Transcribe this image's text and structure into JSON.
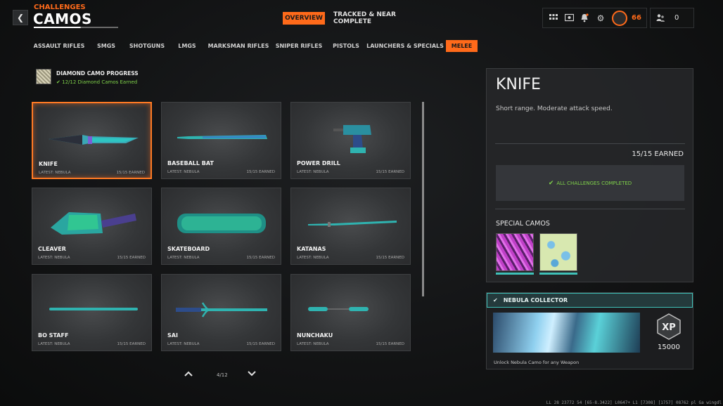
{
  "header": {
    "back_icon": "chevron-left-icon",
    "subtitle": "CHALLENGES",
    "title": "CAMOS",
    "tabs": [
      {
        "label": "OVERVIEW",
        "active": true
      },
      {
        "label": "TRACKED & NEAR COMPLETE",
        "active": false
      }
    ],
    "icons": [
      "grid-menu-icon",
      "wallet-icon",
      "bell-icon",
      "gear-icon"
    ],
    "level": "66",
    "friends_count": "0",
    "accent_color": "#ff6a1a"
  },
  "weapon_classes": [
    {
      "label": "ASSAULT RIFLES",
      "active": false
    },
    {
      "label": "SMGS",
      "active": false
    },
    {
      "label": "SHOTGUNS",
      "active": false
    },
    {
      "label": "LMGS",
      "active": false
    },
    {
      "label": "MARKSMAN RIFLES",
      "active": false
    },
    {
      "label": "SNIPER RIFLES",
      "active": false
    },
    {
      "label": "PISTOLS",
      "active": false
    },
    {
      "label": "LAUNCHERS & SPECIALS",
      "active": false
    },
    {
      "label": "MELEE",
      "active": true
    }
  ],
  "diamond_progress": {
    "title": "DIAMOND CAMO PROGRESS",
    "status": "12/12 Diamond Camos Earned"
  },
  "weapons": [
    {
      "name": "KNIFE",
      "latest": "LATEST: NEBULA",
      "earned": "15/15 EARNED",
      "selected": true
    },
    {
      "name": "BASEBALL BAT",
      "latest": "LATEST: NEBULA",
      "earned": "15/15 EARNED",
      "selected": false
    },
    {
      "name": "POWER DRILL",
      "latest": "LATEST: NEBULA",
      "earned": "15/15 EARNED",
      "selected": false
    },
    {
      "name": "CLEAVER",
      "latest": "LATEST: NEBULA",
      "earned": "15/15 EARNED",
      "selected": false
    },
    {
      "name": "SKATEBOARD",
      "latest": "LATEST: NEBULA",
      "earned": "15/15 EARNED",
      "selected": false
    },
    {
      "name": "KATANAS",
      "latest": "LATEST: NEBULA",
      "earned": "15/15 EARNED",
      "selected": false
    },
    {
      "name": "BO STAFF",
      "latest": "LATEST: NEBULA",
      "earned": "15/15 EARNED",
      "selected": false
    },
    {
      "name": "SAI",
      "latest": "LATEST: NEBULA",
      "earned": "15/15 EARNED",
      "selected": false
    },
    {
      "name": "NUNCHAKU",
      "latest": "LATEST: NEBULA",
      "earned": "15/15 EARNED",
      "selected": false
    }
  ],
  "pager": {
    "label": "4/12"
  },
  "detail": {
    "title": "KNIFE",
    "description": "Short range. Moderate attack speed.",
    "earned": "15/15 EARNED",
    "complete_text": "ALL CHALLENGES COMPLETED",
    "special_label": "SPECIAL CAMOS"
  },
  "challenge": {
    "title": "NEBULA COLLECTOR",
    "xp_label": "XP",
    "xp_amount": "15000",
    "description": "Unlock Nebula Camo for any Weapon"
  },
  "footer": {
    "code": "LL 28 23772 54 [65-8.3422] L0647+ L1 [7308] [1757] 08762 pl Ga wingdl"
  },
  "colors": {
    "accent": "#ff6a1a",
    "success": "#7fd14a",
    "teal": "#3fc1b8"
  }
}
